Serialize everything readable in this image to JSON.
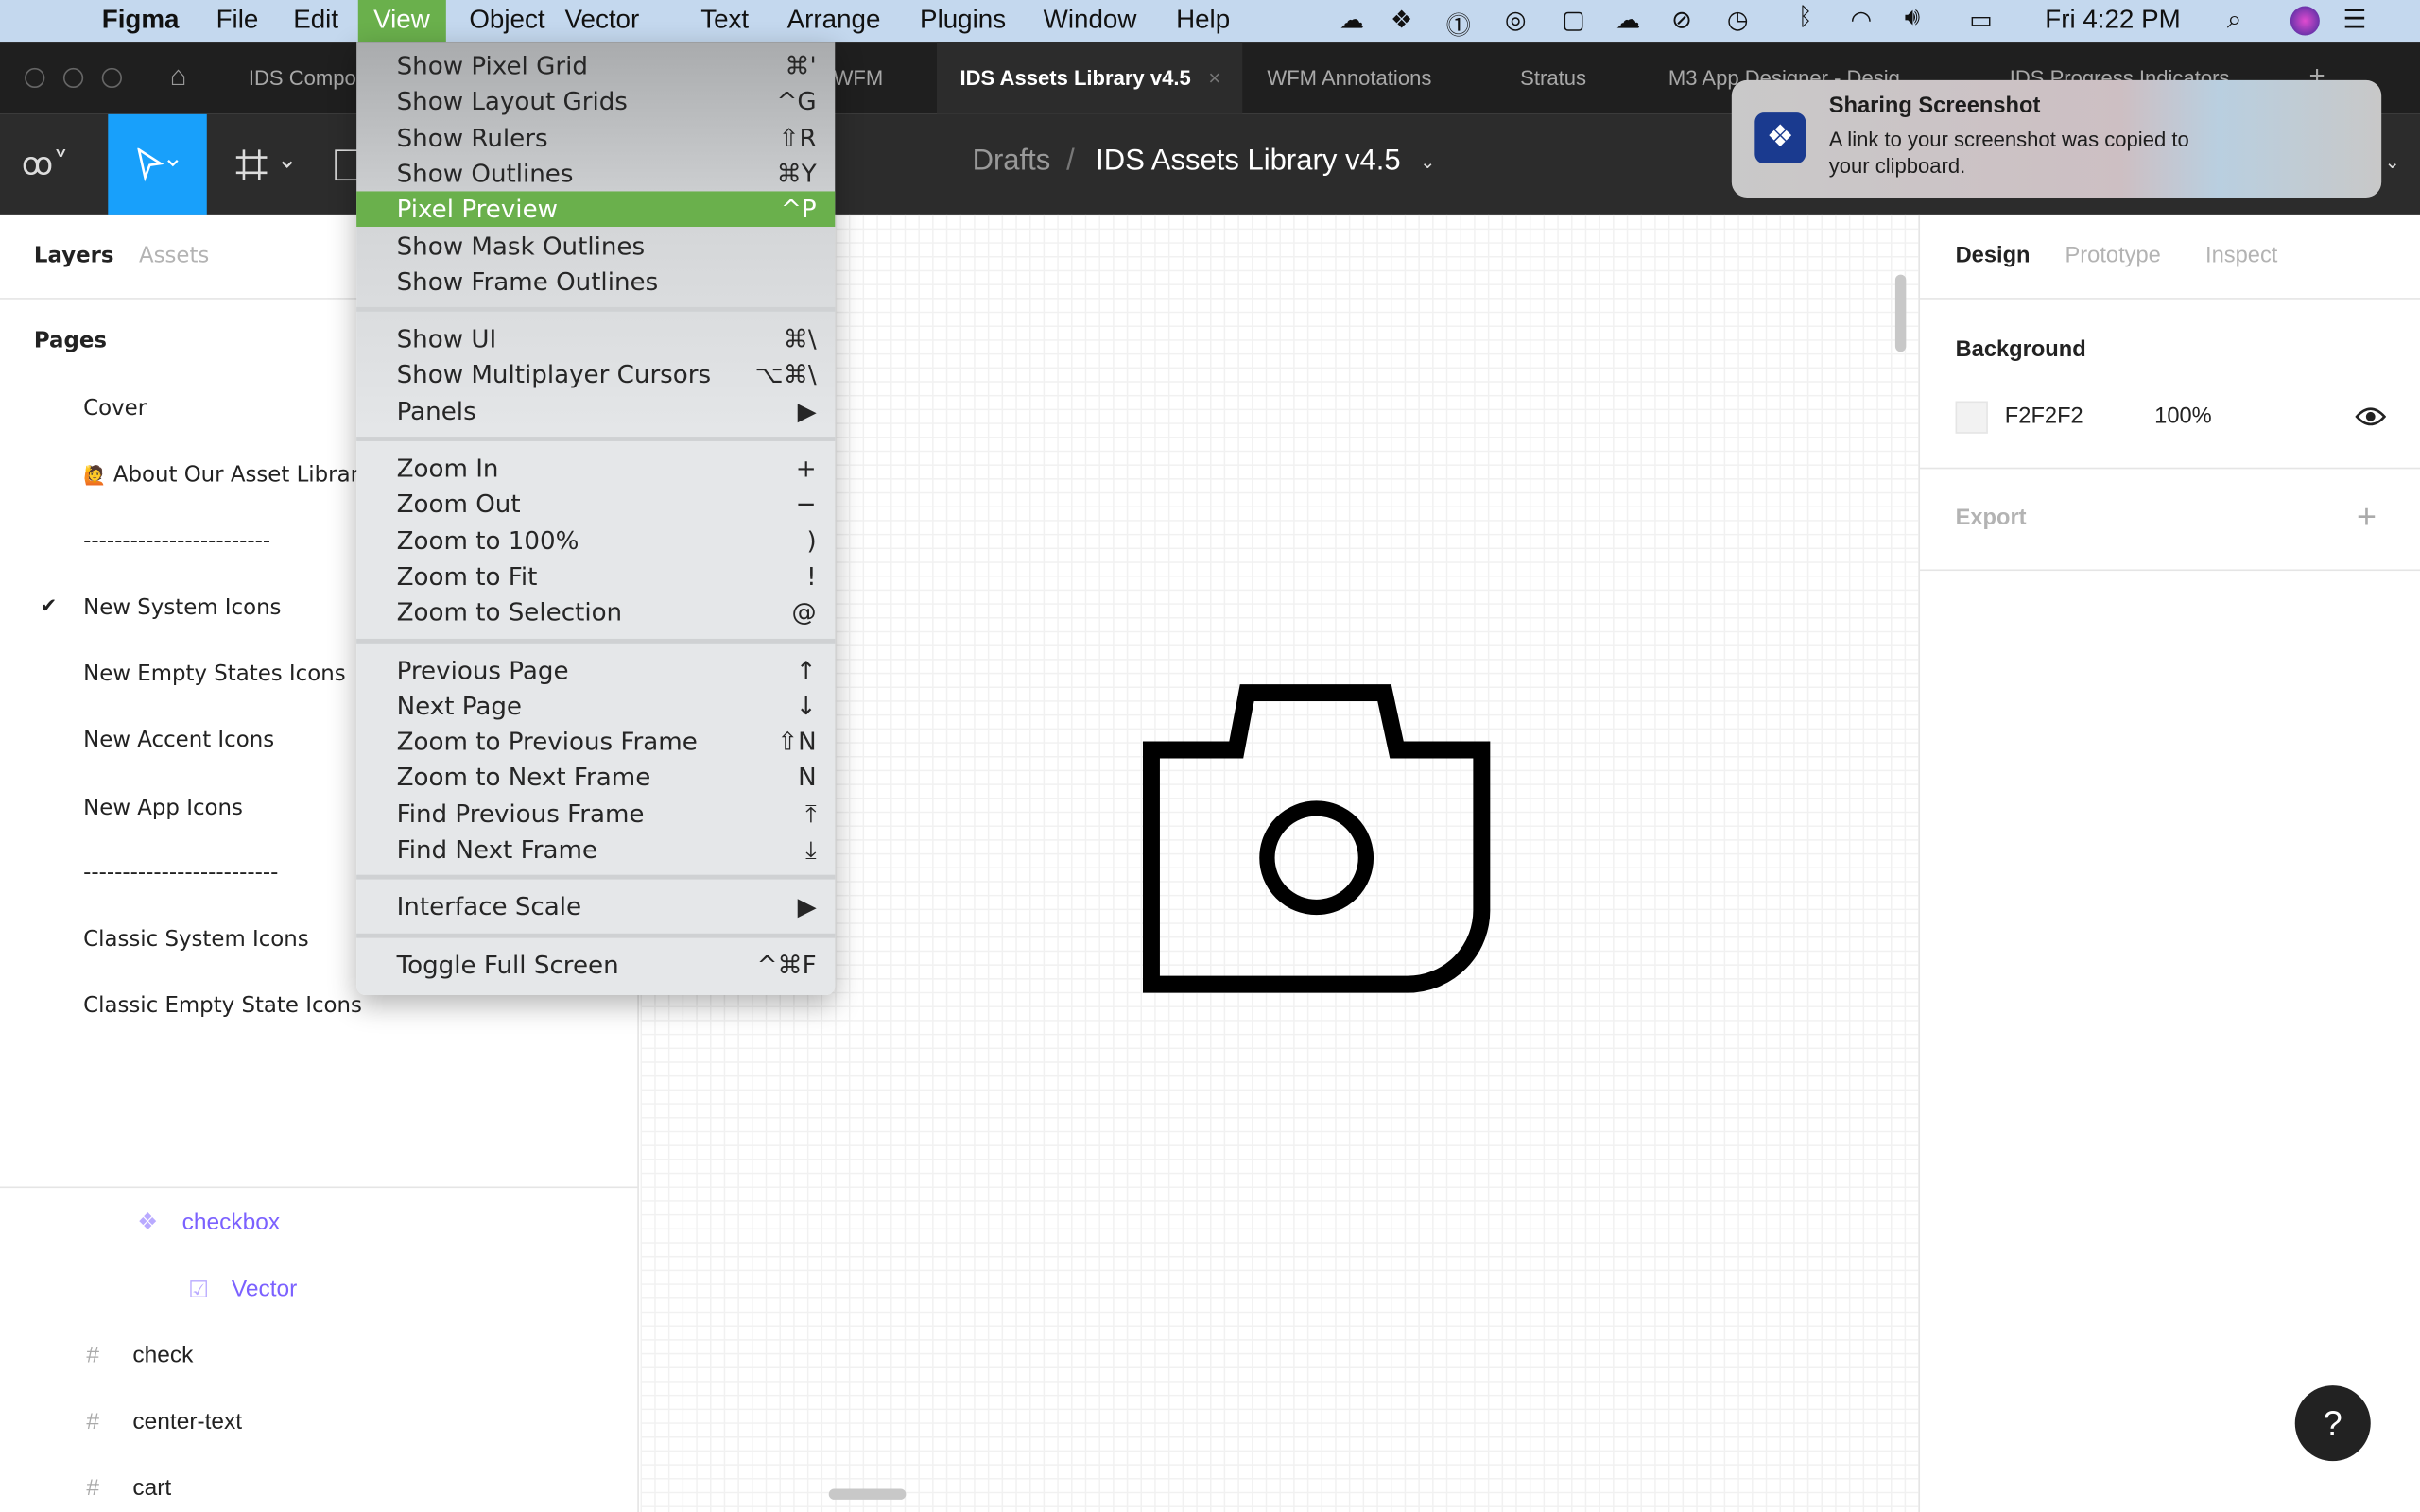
{
  "menubar": {
    "app": "Figma",
    "items": [
      "File",
      "Edit",
      "View",
      "Object",
      "Vector",
      "Text",
      "Arrange",
      "Plugins",
      "Window",
      "Help"
    ],
    "selected": "View",
    "clock": "Fri 4:22 PM",
    "highlight_color": "#6ab04c"
  },
  "tabs": [
    {
      "label": "IDS Compo"
    },
    {
      "label": "WFM"
    },
    {
      "label": "IDS Assets Library v4.5",
      "active": true
    },
    {
      "label": "WFM Annotations"
    },
    {
      "label": "Stratus"
    },
    {
      "label": "M3 App Designer - Desig"
    },
    {
      "label": "IDS Progress Indicators"
    }
  ],
  "toolbar": {
    "breadcrumb_root": "Drafts",
    "breadcrumb_sep": "/",
    "file_name": "IDS Assets Library v4.5",
    "active_tool_color": "#18a0fb"
  },
  "view_menu": {
    "groups": [
      [
        {
          "label": "Show Pixel Grid",
          "shortcut": "⌘'"
        },
        {
          "label": "Show Layout Grids",
          "shortcut": "^G"
        },
        {
          "label": "Show Rulers",
          "shortcut": "⇧R"
        },
        {
          "label": "Show Outlines",
          "shortcut": "⌘Y"
        },
        {
          "label": "Pixel Preview",
          "shortcut": "^P",
          "highlighted": true
        },
        {
          "label": "Show Mask Outlines",
          "shortcut": ""
        },
        {
          "label": "Show Frame Outlines",
          "shortcut": ""
        }
      ],
      [
        {
          "label": "Show UI",
          "shortcut": "⌘\\"
        },
        {
          "label": "Show Multiplayer Cursors",
          "shortcut": "⌥⌘\\"
        },
        {
          "label": "Panels",
          "shortcut": "▶"
        }
      ],
      [
        {
          "label": "Zoom In",
          "shortcut": "+"
        },
        {
          "label": "Zoom Out",
          "shortcut": "−"
        },
        {
          "label": "Zoom to 100%",
          "shortcut": ")"
        },
        {
          "label": "Zoom to Fit",
          "shortcut": "!"
        },
        {
          "label": "Zoom to Selection",
          "shortcut": "@"
        }
      ],
      [
        {
          "label": "Previous Page",
          "shortcut": "↑"
        },
        {
          "label": "Next Page",
          "shortcut": "↓"
        },
        {
          "label": "Zoom to Previous Frame",
          "shortcut": "⇧N"
        },
        {
          "label": "Zoom to Next Frame",
          "shortcut": "N"
        },
        {
          "label": "Find Previous Frame",
          "shortcut": "⤒"
        },
        {
          "label": "Find Next Frame",
          "shortcut": "⤓"
        }
      ],
      [
        {
          "label": "Interface Scale",
          "shortcut": "▶"
        }
      ],
      [
        {
          "label": "Toggle Full Screen",
          "shortcut": "^⌘F"
        }
      ]
    ]
  },
  "notification": {
    "title": "Sharing Screenshot",
    "body_line1": "A link to your screenshot was copied to",
    "body_line2": "your clipboard."
  },
  "left_panel": {
    "tabs": [
      "Layers",
      "Assets"
    ],
    "pages_title": "Pages",
    "pages": [
      {
        "label": "Cover"
      },
      {
        "label": "About Our Asset Librar",
        "emoji": "🙋"
      },
      {
        "label": "------------------------"
      },
      {
        "label": "New System Icons",
        "current": true
      },
      {
        "label": "New Empty States Icons"
      },
      {
        "label": "New Accent Icons"
      },
      {
        "label": "New App Icons"
      },
      {
        "label": "-------------------------"
      },
      {
        "label": "Classic System Icons"
      },
      {
        "label": "Classic Empty State Icons"
      }
    ],
    "layers": [
      {
        "label": "checkbox",
        "icon": "component-icon",
        "selected": true
      },
      {
        "label": "Vector",
        "icon": "vector-icon",
        "selected": true
      },
      {
        "label": "check",
        "icon": "frame-icon"
      },
      {
        "label": "center-text",
        "icon": "frame-icon"
      },
      {
        "label": "cart",
        "icon": "frame-icon"
      }
    ],
    "selection_color": "#7b61ff"
  },
  "right_panel": {
    "tabs": [
      "Design",
      "Prototype",
      "Inspect"
    ],
    "background_title": "Background",
    "bg_hex": "F2F2F2",
    "bg_opacity": "100%",
    "export_title": "Export"
  },
  "help_label": "?"
}
